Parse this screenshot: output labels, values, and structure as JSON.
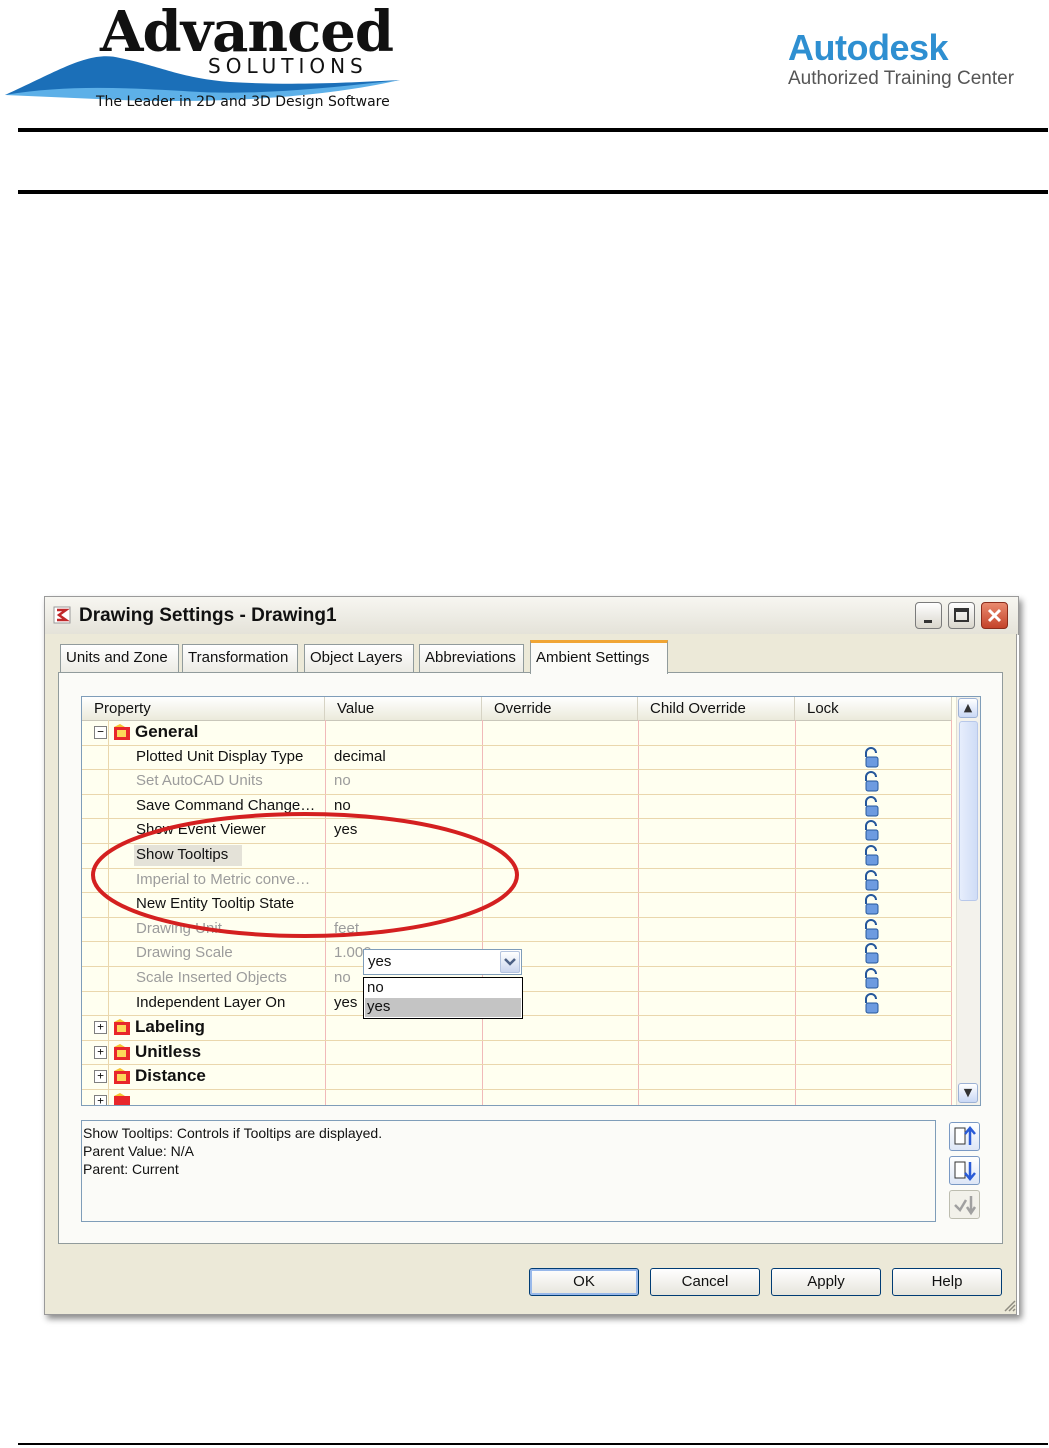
{
  "header": {
    "left_logo": {
      "name": "Advanced",
      "sub": "SOLUTIONS",
      "tagline": "The Leader in 2D and 3D Design Software"
    },
    "right_logo": {
      "name": "Autodesk",
      "sub": "Authorized Training Center"
    }
  },
  "dialog": {
    "title": "Drawing Settings - Drawing1",
    "tabs": [
      {
        "label": "Units and Zone"
      },
      {
        "label": "Transformation"
      },
      {
        "label": "Object Layers"
      },
      {
        "label": "Abbreviations"
      },
      {
        "label": "Ambient Settings",
        "active": true
      }
    ],
    "columns": [
      "Property",
      "Value",
      "Override",
      "Child Override",
      "Lock"
    ],
    "categories": {
      "general": "General",
      "labeling": "Labeling",
      "unitless": "Unitless",
      "distance": "Distance"
    },
    "rows": [
      {
        "property": "Plotted Unit Display Type",
        "value": "decimal",
        "enabled": true
      },
      {
        "property": "Set AutoCAD Units",
        "value": "no",
        "enabled": false
      },
      {
        "property": "Save Command Change…",
        "value": "no",
        "enabled": true
      },
      {
        "property": "Show Event Viewer",
        "value": "yes",
        "enabled": true
      },
      {
        "property": "Show Tooltips",
        "value": "yes",
        "enabled": true,
        "selected": true
      },
      {
        "property": "Imperial to Metric conve…",
        "value": "",
        "enabled": false
      },
      {
        "property": "New Entity Tooltip State",
        "value": "",
        "enabled": true
      },
      {
        "property": "Drawing Unit",
        "value": "feet",
        "enabled": false
      },
      {
        "property": "Drawing Scale",
        "value": "1.000",
        "enabled": false
      },
      {
        "property": "Scale Inserted Objects",
        "value": "no",
        "enabled": false
      },
      {
        "property": "Independent Layer On",
        "value": "yes",
        "enabled": true
      }
    ],
    "combo": {
      "value": "yes",
      "options": [
        "no",
        "yes"
      ],
      "highlighted_option": "yes"
    },
    "description": {
      "line1": "Show Tooltips: Controls if Tooltips are displayed.",
      "line2": "Parent Value: N/A",
      "line3": "Parent: Current"
    },
    "buttons": {
      "ok": "OK",
      "cancel": "Cancel",
      "apply": "Apply",
      "help": "Help"
    }
  },
  "colors": {
    "accent_annotation": "#d42020",
    "autodesk_blue": "#2e8fd1",
    "tab_active_border": "#f0a534",
    "grid_background": "#fffff0"
  }
}
